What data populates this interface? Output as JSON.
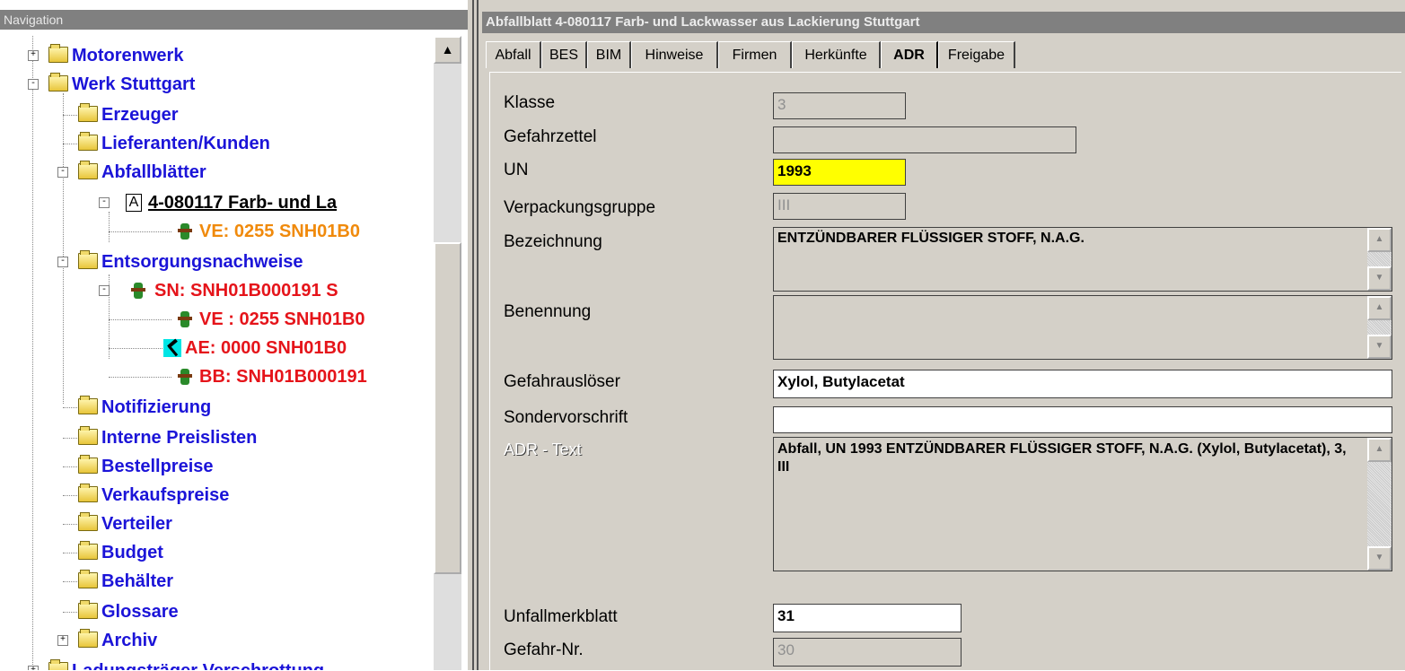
{
  "nav": {
    "header": "Navigation",
    "items": [
      {
        "label": "Motorenwerk",
        "color": "#1b14d8"
      },
      {
        "label": "Werk Stuttgart",
        "color": "#1b14d8"
      },
      {
        "label": "Erzeuger",
        "color": "#1b14d8"
      },
      {
        "label": "Lieferanten/Kunden",
        "color": "#1b14d8"
      },
      {
        "label": "Abfallblätter",
        "color": "#1b14d8"
      },
      {
        "label": "4-080117 Farb- und La",
        "color": "#000000"
      },
      {
        "label": "VE: 0255 SNH01B0",
        "color": "#f08a0c"
      },
      {
        "label": "Entsorgungsnachweise",
        "color": "#1b14d8"
      },
      {
        "label": "SN: SNH01B000191 S",
        "color": "#e5141a"
      },
      {
        "label": "VE : 0255 SNH01B0",
        "color": "#e5141a"
      },
      {
        "label": "AE: 0000 SNH01B0",
        "color": "#e5141a"
      },
      {
        "label": "BB: SNH01B000191",
        "color": "#e5141a"
      },
      {
        "label": "Notifizierung",
        "color": "#1b14d8"
      },
      {
        "label": "Interne Preislisten",
        "color": "#1b14d8"
      },
      {
        "label": "Bestellpreise",
        "color": "#1b14d8"
      },
      {
        "label": "Verkaufspreise",
        "color": "#1b14d8"
      },
      {
        "label": "Verteiler",
        "color": "#1b14d8"
      },
      {
        "label": "Budget",
        "color": "#1b14d8"
      },
      {
        "label": "Behälter",
        "color": "#1b14d8"
      },
      {
        "label": "Glossare",
        "color": "#1b14d8"
      },
      {
        "label": "Archiv",
        "color": "#1b14d8"
      },
      {
        "label": "Ladungsträger Verschrottung",
        "color": "#1b14d8"
      }
    ],
    "icon_a": "A"
  },
  "window": {
    "title": "Abfallblatt 4-080117 Farb- und Lackwasser aus Lackierung Stuttgart"
  },
  "tabs": [
    {
      "label": "Abfall"
    },
    {
      "label": "BES"
    },
    {
      "label": "BIM"
    },
    {
      "label": "Hinweise"
    },
    {
      "label": "Firmen"
    },
    {
      "label": "Herkünfte"
    },
    {
      "label": "ADR"
    },
    {
      "label": "Freigabe"
    }
  ],
  "form": {
    "klasse_label": "Klasse",
    "klasse_value": "3",
    "gefahrzettel_label": "Gefahrzettel",
    "gefahrzettel_value": "",
    "un_label": "UN",
    "un_value": "1993",
    "verpackungsgruppe_label": "Verpackungsgruppe",
    "verpackungsgruppe_value": "III",
    "bezeichnung_label": "Bezeichnung",
    "bezeichnung_value": "ENTZÜNDBARER FLÜSSIGER STOFF, N.A.G.",
    "benennung_label": "Benennung",
    "benennung_value": "",
    "gefahrausloeser_label": "Gefahrauslöser",
    "gefahrausloeser_value": "Xylol, Butylacetat",
    "sondervorschrift_label": "Sondervorschrift",
    "sondervorschrift_value": "",
    "adr_text_label": "ADR - Text",
    "adr_text_value": "Abfall, UN 1993 ENTZÜNDBARER FLÜSSIGER STOFF, N.A.G. (Xylol, Butylacetat), 3, III",
    "unfallmerkblatt_label": "Unfallmerkblatt",
    "unfallmerkblatt_value": "31",
    "gefahr_nr_label": "Gefahr-Nr.",
    "gefahr_nr_value": "30"
  },
  "colors": {
    "un_highlight": "#ffff00",
    "panel_bg": "#d4d0c8",
    "header_bg": "#808080"
  }
}
